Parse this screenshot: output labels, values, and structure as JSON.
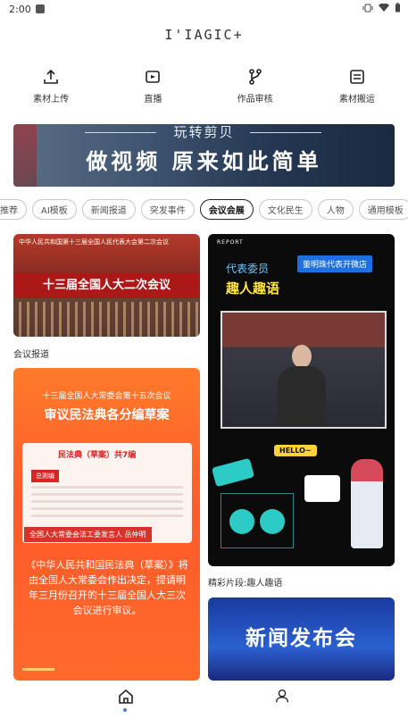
{
  "status": {
    "time": "2:00"
  },
  "app": {
    "logo": "I'IAGIC+"
  },
  "actions": [
    {
      "label": "素材上传",
      "icon": "upload-icon"
    },
    {
      "label": "直播",
      "icon": "live-icon"
    },
    {
      "label": "作品审核",
      "icon": "review-icon"
    },
    {
      "label": "素材搬运",
      "icon": "transfer-icon"
    }
  ],
  "banner": {
    "top": "玩转剪贝",
    "main": "做视频 原来如此简单"
  },
  "tags": [
    "推荐",
    "AI模板",
    "新闻报道",
    "突发事件",
    "会议会展",
    "文化民生",
    "人物",
    "通用模板"
  ],
  "active_tag": "会议会展",
  "cards": {
    "c1": {
      "header": "中华人民共和国第十三届全国人民代表大会第二次会议",
      "title": "十三届全国人大二次会议",
      "caption": "会议报道"
    },
    "c2": {
      "report": "REPORT",
      "badge": "董明珠代表开微店",
      "line1": "代表委员",
      "line2": "趣人趣语",
      "hello": "HELLO~",
      "caption": "精彩片段:趣人趣语"
    },
    "c3": {
      "line1": "十三届全国人大常委会第十五次会议",
      "line2": "审议民法典各分编草案",
      "doc_title": "民法典（草案）共7编",
      "doc_badge": "总则编",
      "speaker": "全国人大常委会法工委发言人 岳仲明",
      "body": "《中华人民共和国民法典（草案）》将由全国人大常委会作出决定，提请明年三月份召开的十三届全国人大三次会议进行审议。"
    },
    "c4": {
      "title": "新闻发布会"
    }
  },
  "nav": {
    "home": "home-icon",
    "profile": "user-icon"
  }
}
